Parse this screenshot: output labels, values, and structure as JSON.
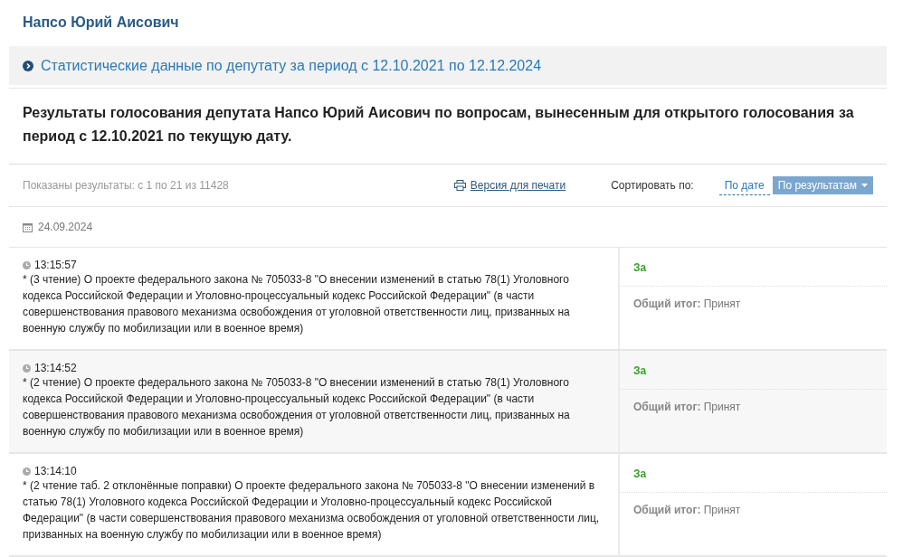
{
  "deputy": {
    "name": "Напсо Юрий Аисович"
  },
  "stats_link": {
    "label": "Статистические данные по депутату за период с 12.10.2021 по 12.12.2024"
  },
  "heading": "Результаты голосования депутата Напсо Юрий Аисович по вопросам, вынесенным для открытого голосования за период с 12.10.2021 по текущую дату.",
  "toolbar": {
    "results_count": "Показаны результаты: с 1 по 21 из 11428",
    "print_link": "Версия для печати",
    "sort_label": "Сортировать по:",
    "sort_options": [
      {
        "label": "По дате",
        "selected": false
      },
      {
        "label": "По результатам",
        "selected": true
      }
    ]
  },
  "date": "24.09.2024",
  "votes": [
    {
      "time": "13:15:57",
      "text": "* (3 чтение) О проекте федерального закона № 705033-8 \"О внесении изменений в статью 78(1) Уголовного кодекса Российской Федерации и Уголовно-процессуальный кодекс Российской Федерации\" (в части совершенствования правового механизма освобождения от уголовной ответственности лиц, призванных на военную службу по мобилизации или в военное время)",
      "vote": "За",
      "color": "#3aa12a",
      "result_label": "Общий итог:",
      "result": "Принят"
    },
    {
      "time": "13:14:52",
      "text": "* (2 чтение) О проекте федерального закона № 705033-8 \"О внесении изменений в статью 78(1) Уголовного кодекса Российской Федерации и Уголовно-процессуальный кодекс Российской Федерации\" (в части совершенствования правового механизма освобождения от уголовной ответственности лиц, призванных на военную службу по мобилизации или в военное время)",
      "vote": "За",
      "color": "#3aa12a",
      "result_label": "Общий итог:",
      "result": "Принят"
    },
    {
      "time": "13:14:10",
      "text": "* (2 чтение таб. 2 отклонённые поправки) О проекте федерального закона № 705033-8 \"О внесении изменений в статью 78(1) Уголовного кодекса Российской Федерации и Уголовно-процессуальный кодекс Российской Федерации\" (в части совершенствования правового механизма освобождения от уголовной ответственности лиц, призванных на военную службу по мобилизации или в военное время)",
      "vote": "За",
      "color": "#3aa12a",
      "result_label": "Общий итог:",
      "result": "Принят"
    }
  ]
}
